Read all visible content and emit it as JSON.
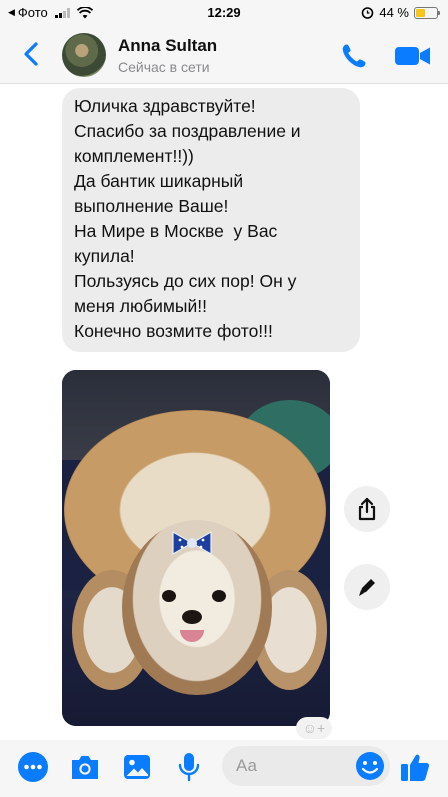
{
  "status_bar": {
    "back_app": "Фото",
    "time": "12:29",
    "battery": "44 %",
    "battery_level": 0.44
  },
  "header": {
    "contact_name": "Anna Sultan",
    "contact_status": "Сейчас в сети",
    "icons": {
      "back": "chevron-left-icon",
      "call": "phone-icon",
      "video": "video-camera-icon"
    },
    "accent_color": "#0a7cff"
  },
  "messages": [
    {
      "type": "text",
      "lines": [
        "Юличка здравствуйте!",
        "Спасибо за поздравление и",
        "комплемент!!))",
        "Да бантик шикарный",
        "выполнение Ваше!",
        "На Мире в Москве  у Вас",
        "купила!",
        "Пользуясь до сих пор! Он у",
        "меня любимый!!",
        "Конечно возмите фото!!!"
      ]
    },
    {
      "type": "photo",
      "subject": "shih-tzu dog with blue bow"
    }
  ],
  "side_actions": [
    "share-icon",
    "edit-icon"
  ],
  "composer": {
    "placeholder": "Аа",
    "icons": [
      "more-icon",
      "camera-icon",
      "gallery-icon",
      "microphone-icon",
      "emoji-icon",
      "thumbs-up-icon"
    ]
  }
}
